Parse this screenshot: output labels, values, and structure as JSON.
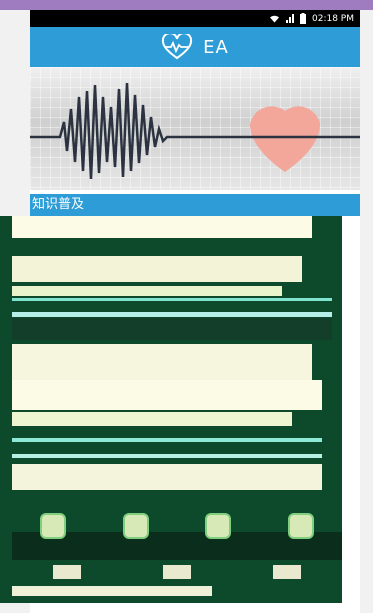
{
  "status_bar": {
    "time": "02:18 PM",
    "icons": [
      "wifi-icon",
      "signal-icon",
      "battery-icon"
    ]
  },
  "app_bar": {
    "title": "EA",
    "logo_icon": "heart-pulse-icon"
  },
  "section": {
    "title": "知识普及"
  },
  "colors": {
    "accent": "#2e9cd6",
    "banner_heart": "#f2a79a",
    "ecg_line": "#2b3340",
    "frame_top": "#9f7cc0"
  }
}
